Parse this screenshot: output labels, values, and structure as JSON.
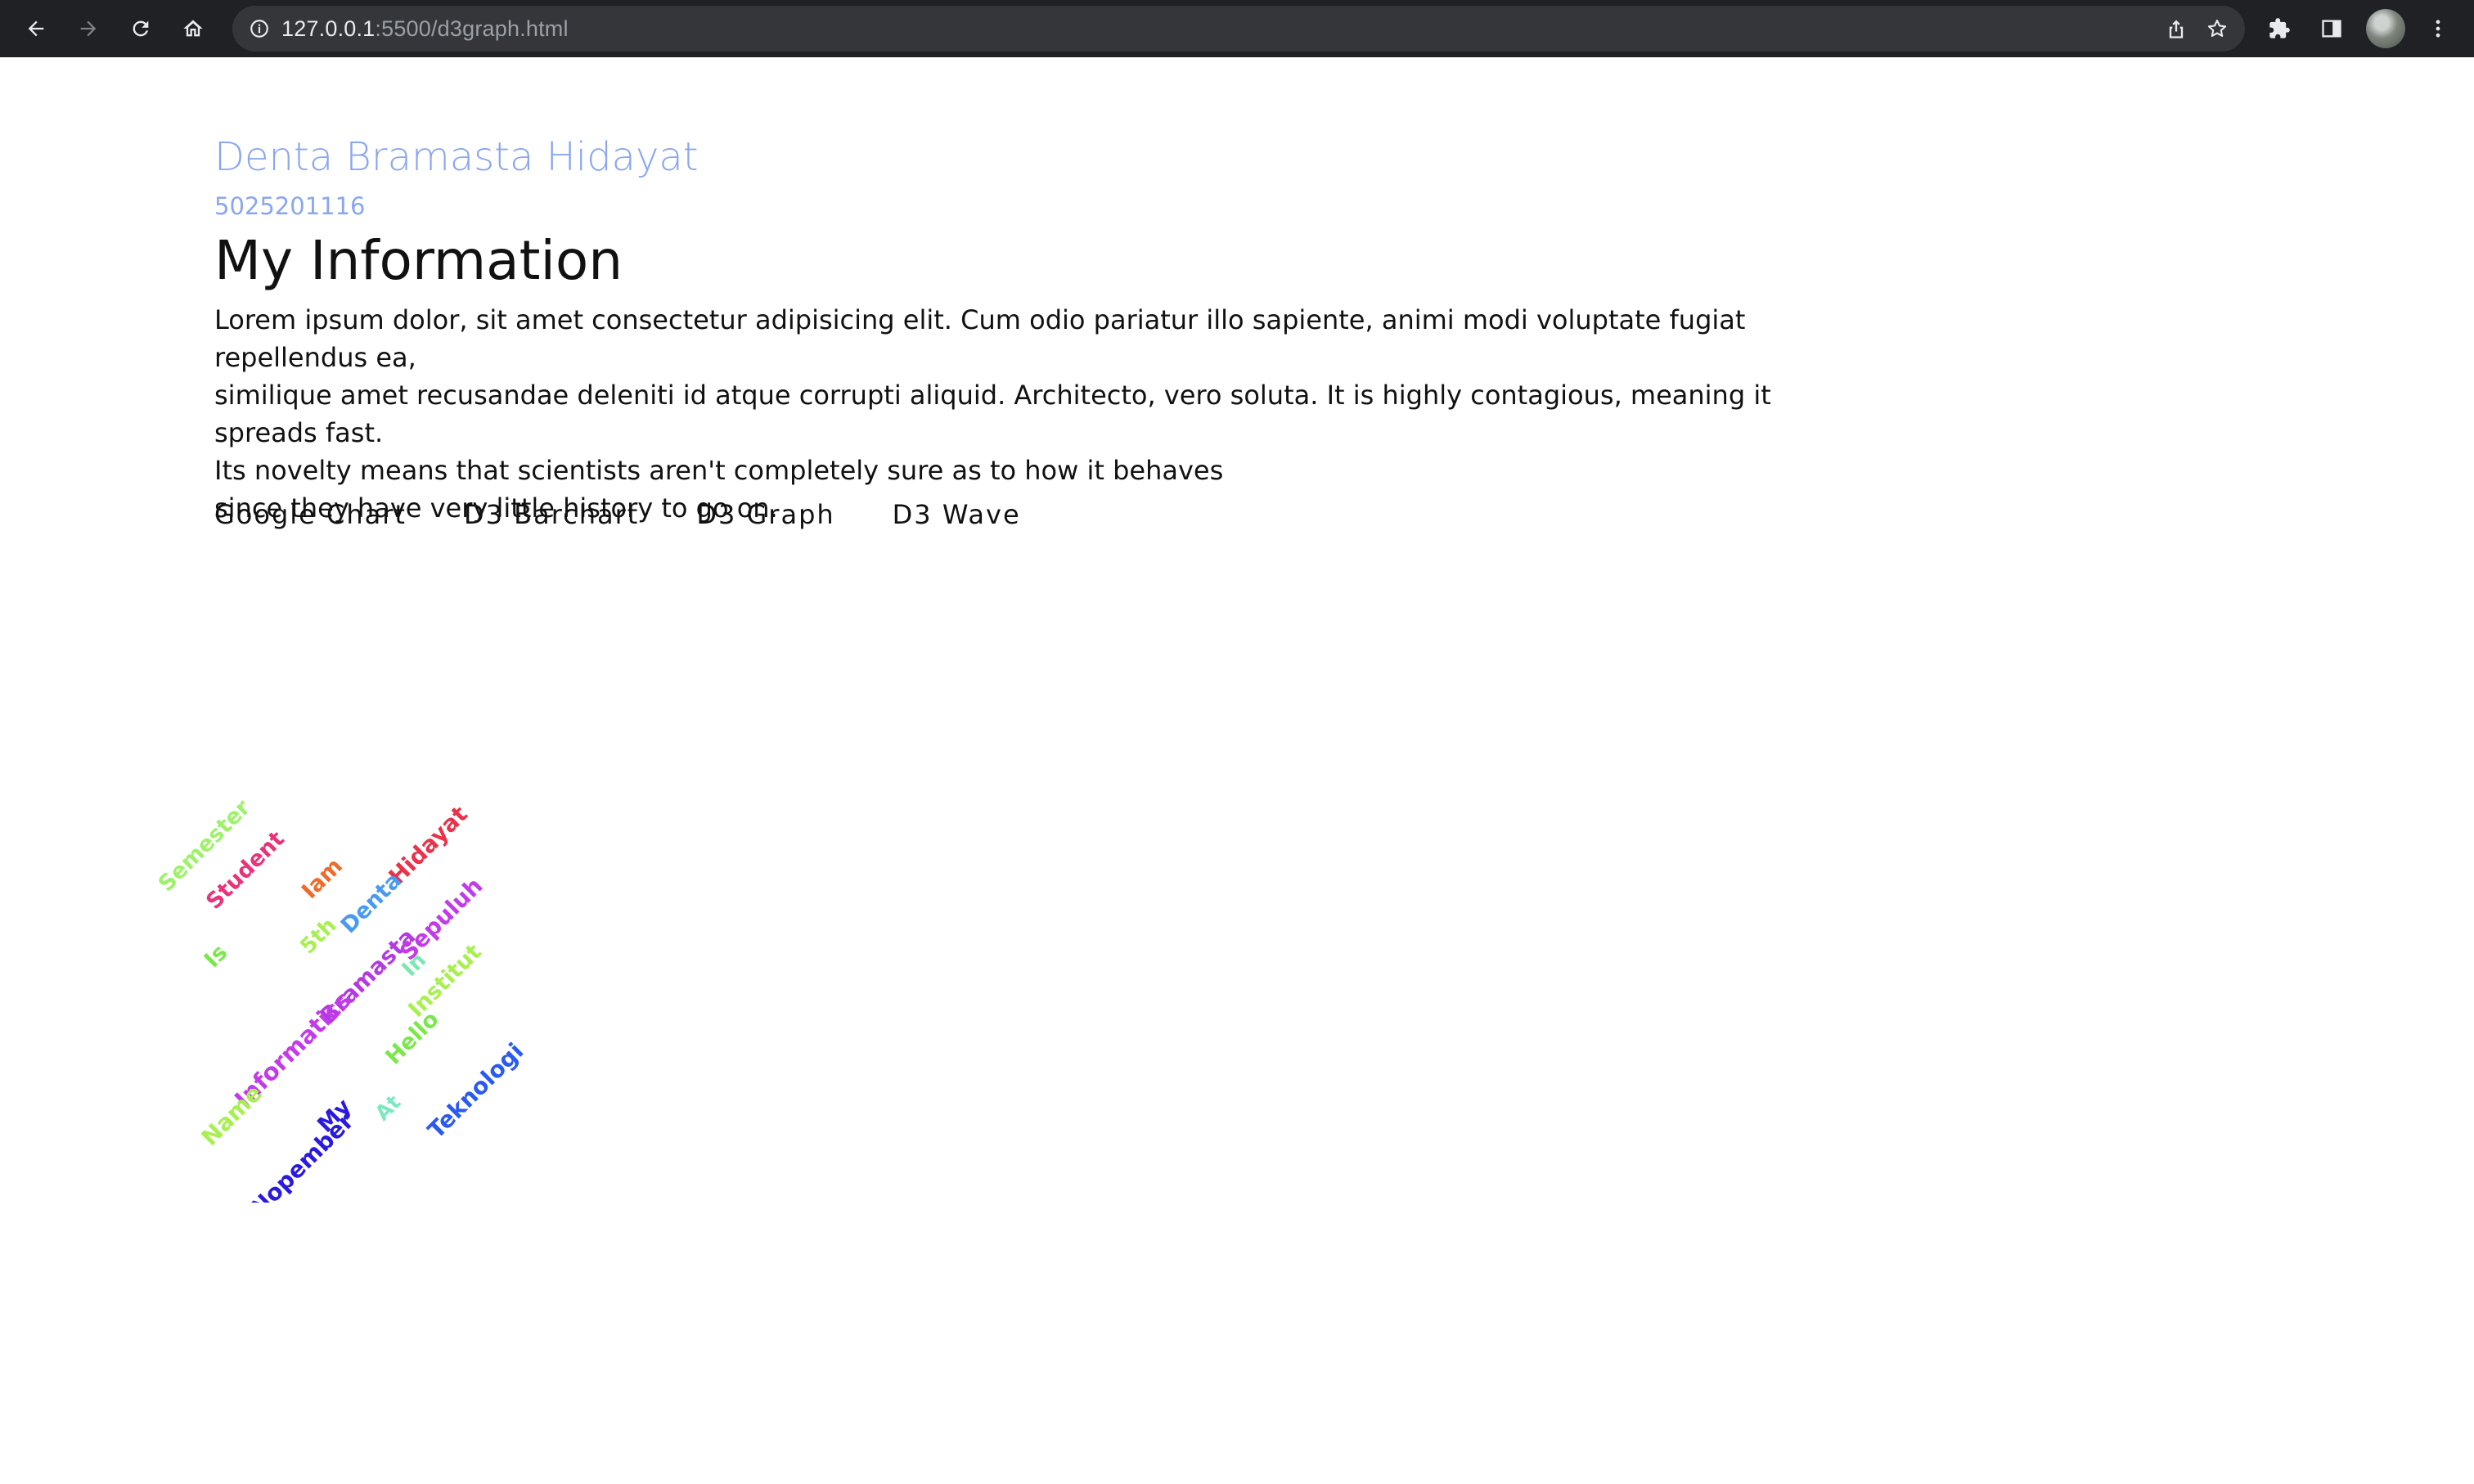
{
  "browser": {
    "url_host": "127.0.0.1",
    "url_rest": ":5500/d3graph.html"
  },
  "page": {
    "name": "Denta Bramasta Hidayat",
    "nrp": "5025201116",
    "heading": "My Information",
    "paragraph_lines": [
      "Lorem ipsum dolor, sit amet consectetur adipisicing elit. Cum odio pariatur illo sapiente, animi modi voluptate fugiat repellendus ea,",
      "similique amet recusandae deleniti id atque corrupti aliquid. Architecto, vero soluta. It is highly contagious, meaning it spreads fast.",
      "Its novelty means that scientists aren't completely sure as to how it behaves",
      "since they have very little history to go on."
    ],
    "nav_links": [
      "Google Chart",
      "D3 Barchart",
      "D3 Graph",
      "D3 Wave"
    ]
  },
  "word_cloud": {
    "words": [
      {
        "text": "Semester",
        "color": "#9ef26a"
      },
      {
        "text": "Student",
        "color": "#e8337a"
      },
      {
        "text": "Iam",
        "color": "#f06a2a"
      },
      {
        "text": "Hidayat",
        "color": "#e8334a"
      },
      {
        "text": "Denta",
        "color": "#4a9af0"
      },
      {
        "text": "5th",
        "color": "#a8f050"
      },
      {
        "text": "Bramasta",
        "color": "#b33ae0"
      },
      {
        "text": "Sepuluh",
        "color": "#c33ae8"
      },
      {
        "text": "Is",
        "color": "#7ae84a"
      },
      {
        "text": "In",
        "color": "#7ae8b0"
      },
      {
        "text": "Institut",
        "color": "#a8f050"
      },
      {
        "text": "Informatics",
        "color": "#c33ae8"
      },
      {
        "text": "Hello",
        "color": "#7ae84a"
      },
      {
        "text": "Name",
        "color": "#a8f050"
      },
      {
        "text": "Teknologi",
        "color": "#2a5af0"
      },
      {
        "text": "Nopember",
        "color": "#2a1ae0"
      },
      {
        "text": "My",
        "color": "#2a1ae0"
      },
      {
        "text": "At",
        "color": "#7ae8c0"
      }
    ]
  }
}
